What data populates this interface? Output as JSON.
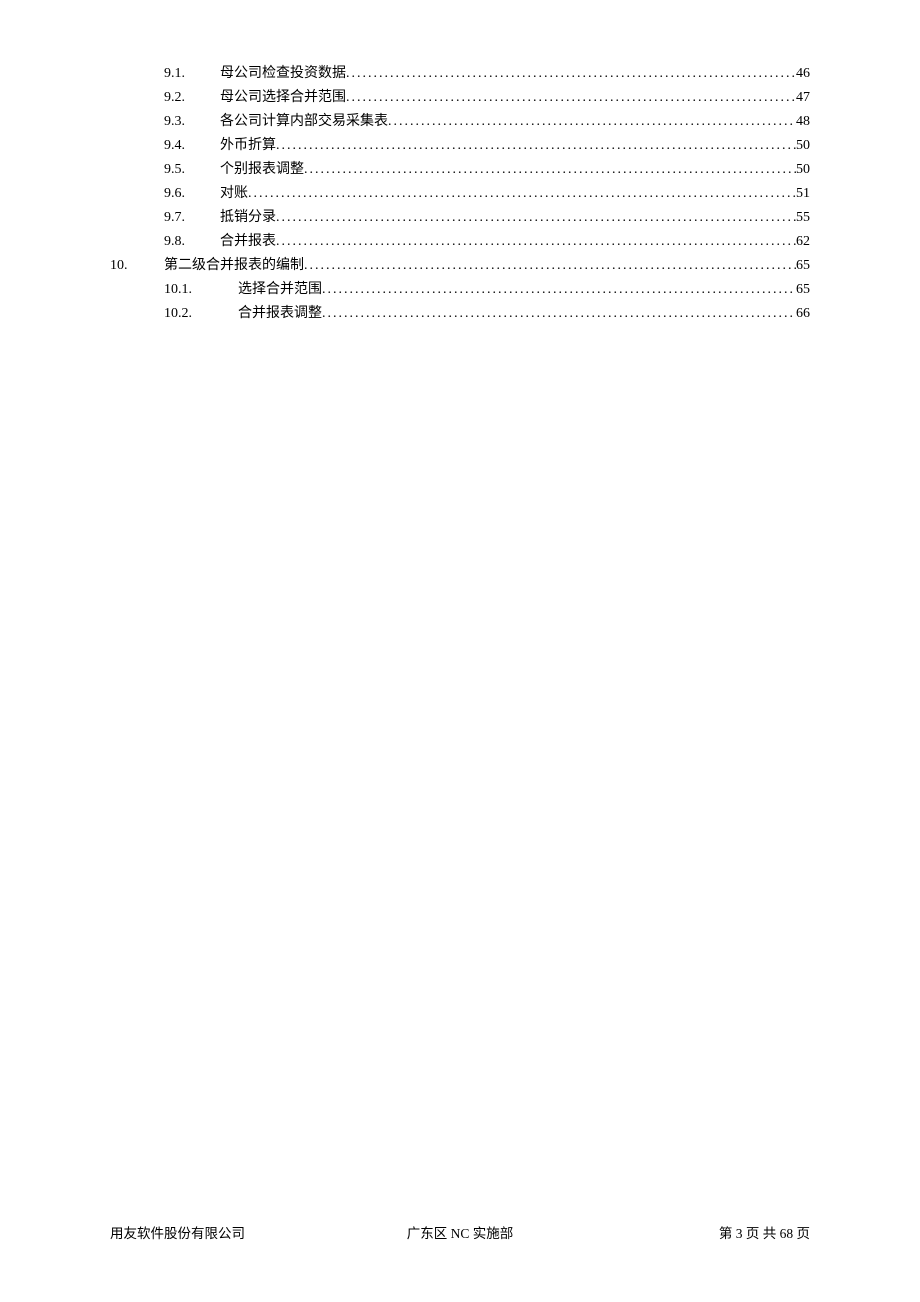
{
  "toc": {
    "entries": [
      {
        "level": "sub",
        "num": "9.1.",
        "title": "母公司检查投资数据",
        "page": "46"
      },
      {
        "level": "sub",
        "num": "9.2.",
        "title": "母公司选择合并范围",
        "page": "47"
      },
      {
        "level": "sub",
        "num": "9.3.",
        "title": "各公司计算内部交易采集表",
        "page": "48"
      },
      {
        "level": "sub",
        "num": "9.4.",
        "title": "外币折算",
        "page": "50"
      },
      {
        "level": "sub",
        "num": "9.5.",
        "title": "个别报表调整",
        "page": "50"
      },
      {
        "level": "sub",
        "num": "9.6.",
        "title": "对账",
        "page": "51"
      },
      {
        "level": "sub",
        "num": "9.7.",
        "title": "抵销分录",
        "page": "55"
      },
      {
        "level": "sub",
        "num": "9.8.",
        "title": "合并报表",
        "page": "62"
      },
      {
        "level": "main",
        "num": "10.",
        "title": "第二级合并报表的编制",
        "page": "65"
      },
      {
        "level": "sub2",
        "num": "10.1.",
        "title": "选择合并范围",
        "page": "65"
      },
      {
        "level": "sub2",
        "num": "10.2.",
        "title": "合并报表调整",
        "page": "66"
      }
    ]
  },
  "footer": {
    "left": "用友软件股份有限公司",
    "center": "广东区 NC 实施部",
    "right": "第 3 页 共 68 页"
  },
  "dots": "............................................................................................................................................................................................................."
}
